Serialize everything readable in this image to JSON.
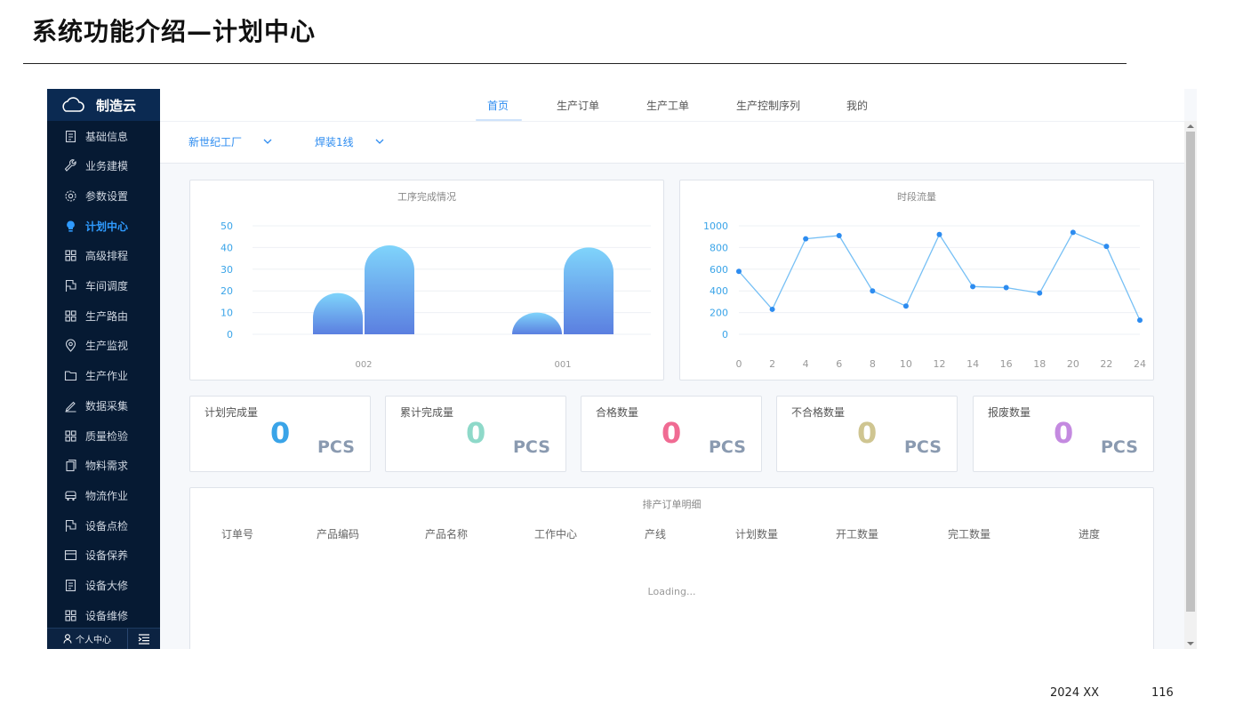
{
  "slide": {
    "title": "系统功能介绍—计划中心",
    "date": "2024 XX",
    "page": "116"
  },
  "sidebar": {
    "brand": "制造云",
    "items": [
      {
        "label": "基础信息",
        "icon": "document-icon"
      },
      {
        "label": "业务建模",
        "icon": "wrench-icon"
      },
      {
        "label": "参数设置",
        "icon": "gear-icon"
      },
      {
        "label": "计划中心",
        "icon": "bulb-icon",
        "active": true
      },
      {
        "label": "高级排程",
        "icon": "grid-icon"
      },
      {
        "label": "车间调度",
        "icon": "flag-icon"
      },
      {
        "label": "生产路由",
        "icon": "grid-icon"
      },
      {
        "label": "生产监视",
        "icon": "location-icon"
      },
      {
        "label": "生产作业",
        "icon": "folder-icon"
      },
      {
        "label": "数据采集",
        "icon": "pen-icon"
      },
      {
        "label": "质量检验",
        "icon": "grid-icon"
      },
      {
        "label": "物料需求",
        "icon": "copy-icon"
      },
      {
        "label": "物流作业",
        "icon": "truck-icon"
      },
      {
        "label": "设备点检",
        "icon": "flag-icon"
      },
      {
        "label": "设备保养",
        "icon": "card-icon"
      },
      {
        "label": "设备大修",
        "icon": "document-icon"
      },
      {
        "label": "设备维修",
        "icon": "grid-icon"
      }
    ],
    "footer": {
      "personal": "个人中心"
    }
  },
  "topnav": {
    "tabs": [
      "首页",
      "生产订单",
      "生产工单",
      "生产控制序列",
      "我的"
    ],
    "active": 0
  },
  "filters": {
    "factory": "新世纪工厂",
    "line": "焊装1线"
  },
  "charts": {
    "process": {
      "title": "工序完成情况"
    },
    "flow": {
      "title": "时段流量"
    }
  },
  "chart_data": [
    {
      "type": "bar",
      "title": "工序完成情况",
      "categories": [
        "002",
        "001"
      ],
      "series": [
        {
          "values": [
            19,
            10
          ]
        },
        {
          "values": [
            41,
            40
          ]
        }
      ],
      "ylim": [
        0,
        50
      ],
      "yticks": [
        0,
        10,
        20,
        30,
        40,
        50
      ],
      "grid": true
    },
    {
      "type": "line",
      "title": "时段流量",
      "x": [
        0,
        2,
        4,
        6,
        8,
        10,
        12,
        14,
        16,
        18,
        20,
        22,
        24
      ],
      "series": [
        {
          "values": [
            580,
            230,
            880,
            910,
            400,
            260,
            920,
            440,
            430,
            380,
            940,
            810,
            130
          ]
        }
      ],
      "ylim": [
        0,
        1000
      ],
      "yticks": [
        0,
        200,
        400,
        600,
        800,
        1000
      ],
      "grid": true
    }
  ],
  "stats": [
    {
      "label": "计划完成量",
      "value": "0",
      "unit": "PCS",
      "color": "#3aa4e8"
    },
    {
      "label": "累计完成量",
      "value": "0",
      "unit": "PCS",
      "color": "#8ed9c9"
    },
    {
      "label": "合格数量",
      "value": "0",
      "unit": "PCS",
      "color": "#f06b93"
    },
    {
      "label": "不合格数量",
      "value": "0",
      "unit": "PCS",
      "color": "#cfc591"
    },
    {
      "label": "报废数量",
      "value": "0",
      "unit": "PCS",
      "color": "#c48ae0"
    }
  ],
  "orders": {
    "title": "排产订单明细",
    "columns": [
      "订单号",
      "产品编码",
      "产品名称",
      "工作中心",
      "产线",
      "计划数量",
      "开工数量",
      "完工数量",
      "进度"
    ],
    "loading": "Loading..."
  }
}
